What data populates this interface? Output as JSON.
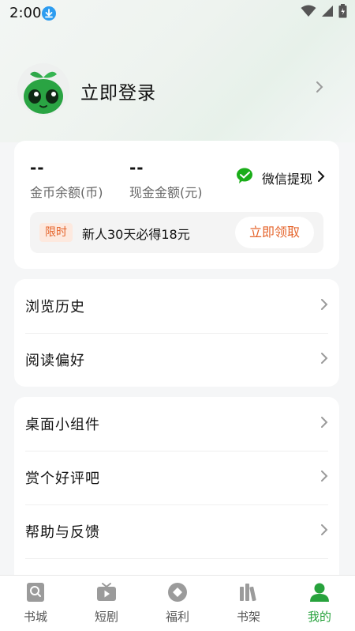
{
  "status_bar": {
    "time": "2:00"
  },
  "profile": {
    "login_label": "立即登录"
  },
  "wallet": {
    "coin_value": "--",
    "coin_label": "金币余额(币)",
    "cash_value": "--",
    "cash_label": "现金金额(元)",
    "wechat_withdraw_label": "微信提现",
    "promo_badge": "限时",
    "promo_text": "新人30天必得18元",
    "claim_label": "立即领取"
  },
  "menu_group_1": [
    {
      "label": "浏览历史"
    },
    {
      "label": "阅读偏好"
    }
  ],
  "menu_group_2": [
    {
      "label": "桌面小组件"
    },
    {
      "label": "赏个好评吧"
    },
    {
      "label": "帮助与反馈"
    }
  ],
  "tabbar": {
    "items": [
      {
        "label": "书城",
        "icon": "search-book-icon"
      },
      {
        "label": "短剧",
        "icon": "tv-icon"
      },
      {
        "label": "福利",
        "icon": "coin-diamond-icon"
      },
      {
        "label": "书架",
        "icon": "bookshelf-icon"
      },
      {
        "label": "我的",
        "icon": "person-icon"
      }
    ],
    "active": "我的"
  },
  "colors": {
    "accent_green": "#27a23c",
    "promo_orange": "#e5642b",
    "download_blue": "#2d9cf0"
  }
}
